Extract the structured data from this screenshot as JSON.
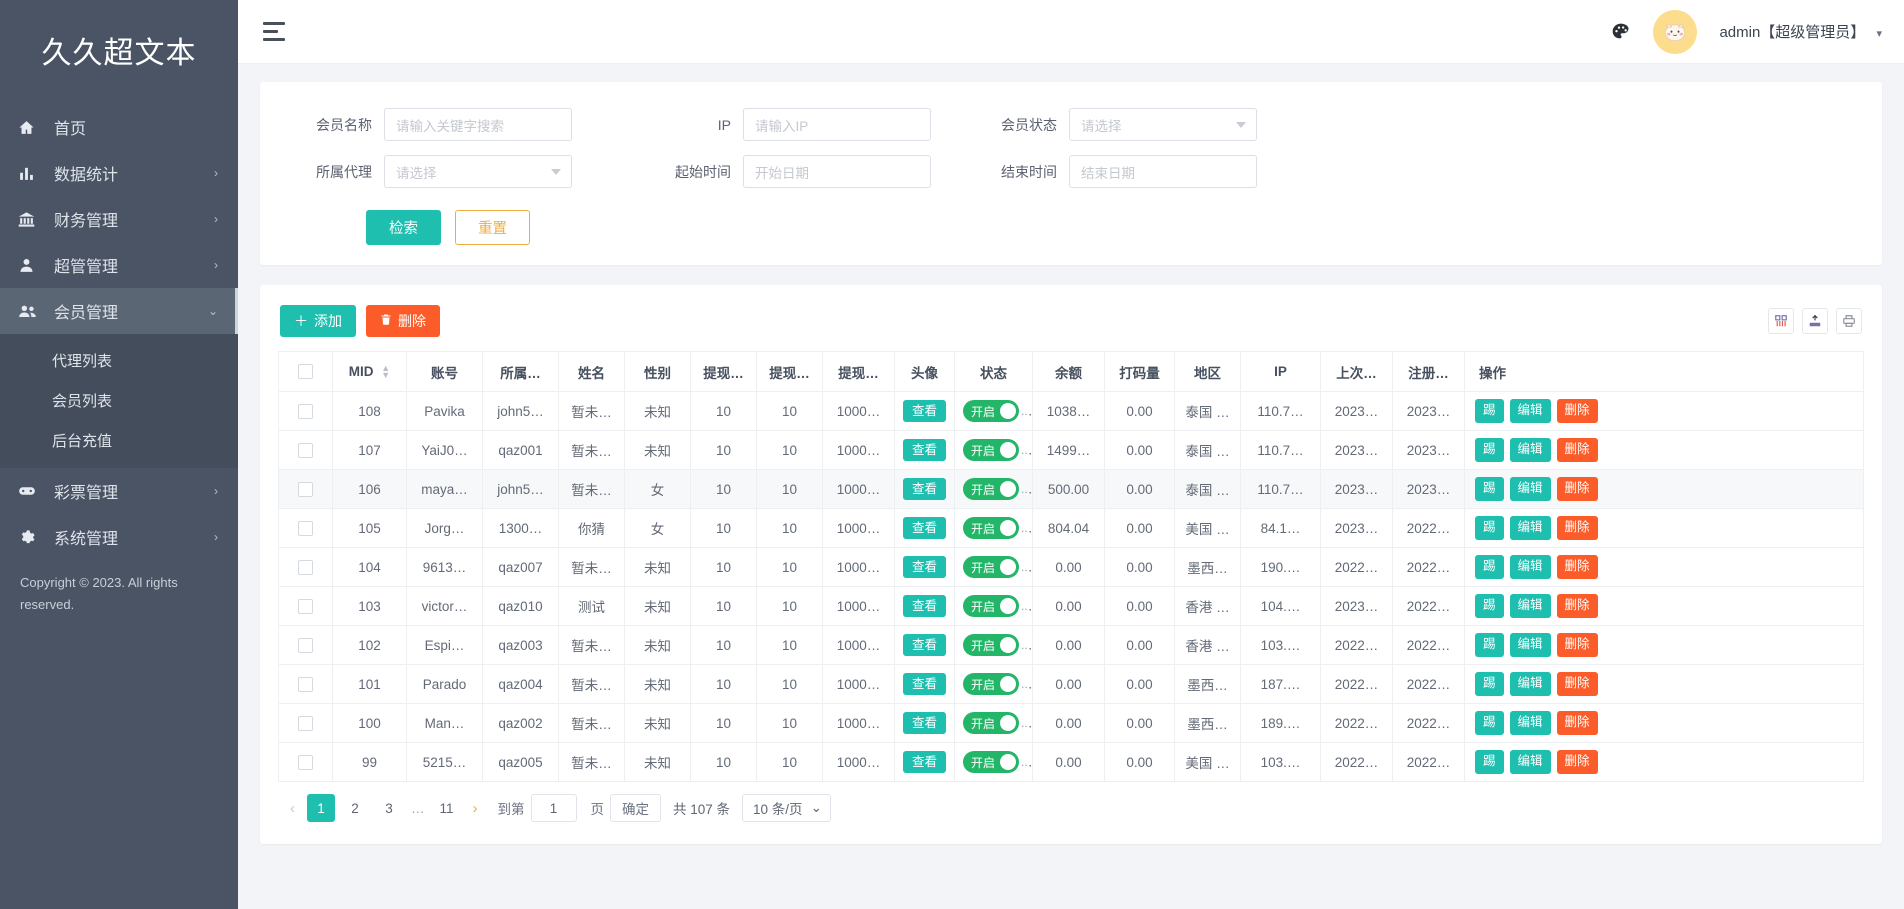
{
  "sidebar": {
    "brand": "久久超文本",
    "items": [
      {
        "label": "首页",
        "icon": "home-icon",
        "arrow": ""
      },
      {
        "label": "数据统计",
        "icon": "chart-bar-icon",
        "arrow": "›"
      },
      {
        "label": "财务管理",
        "icon": "bank-icon",
        "arrow": "›"
      },
      {
        "label": "超管管理",
        "icon": "user-icon",
        "arrow": "›"
      },
      {
        "label": "会员管理",
        "icon": "users-icon",
        "arrow": "⌄"
      },
      {
        "label": "彩票管理",
        "icon": "gamepad-icon",
        "arrow": "›"
      },
      {
        "label": "系统管理",
        "icon": "gear-icon",
        "arrow": "›"
      }
    ],
    "submenu": [
      "代理列表",
      "会员列表",
      "后台充值"
    ],
    "copyright": "Copyright © 2023. All rights reserved."
  },
  "topbar": {
    "menu_icon": "hamburger-icon",
    "palette_icon": "palette-icon",
    "avatar_icon": "avatar-cat-icon",
    "user": "admin【超级管理员】",
    "caret": "▾"
  },
  "search": {
    "fields": [
      {
        "label": "会员名称",
        "placeholder": "请输入关键字搜索",
        "type": "text"
      },
      {
        "label": "IP",
        "placeholder": "请输入IP",
        "type": "text"
      },
      {
        "label": "会员状态",
        "placeholder": "请选择",
        "type": "select"
      },
      {
        "label": "所属代理",
        "placeholder": "请选择",
        "type": "select"
      },
      {
        "label": "起始时间",
        "placeholder": "开始日期",
        "type": "date"
      },
      {
        "label": "结束时间",
        "placeholder": "结束日期",
        "type": "date"
      }
    ],
    "submit_label": "检索",
    "reset_label": "重置"
  },
  "toolbar": {
    "add_label": "添加",
    "add_icon": "plus-icon",
    "delete_label": "删除",
    "delete_icon": "trash-icon",
    "icons": [
      "columns-icon",
      "export-icon",
      "print-icon"
    ]
  },
  "table": {
    "columns": [
      "",
      "MID",
      "账号",
      "所属…",
      "姓名",
      "性别",
      "提现…",
      "提现…",
      "提现…",
      "头像",
      "状态",
      "余额",
      "打码量",
      "地区",
      "IP",
      "上次…",
      "注册…",
      "操作"
    ],
    "sort_column": "MID",
    "view_label": "查看",
    "status_on_label": "开启",
    "actions": [
      "踢",
      "编辑",
      "删除"
    ],
    "rows": [
      {
        "mid": "108",
        "account": "Pavika",
        "agent": "john5…",
        "name": "暂未…",
        "gender": "未知",
        "w1": "10",
        "w2": "10",
        "w3": "1000…",
        "balance": "1038…",
        "bet": "0.00",
        "region": "泰国 …",
        "ip": "110.7…",
        "last": "2023…",
        "reg": "2023…",
        "hover": false
      },
      {
        "mid": "107",
        "account": "YaiJ0…",
        "agent": "qaz001",
        "name": "暂未…",
        "gender": "未知",
        "w1": "10",
        "w2": "10",
        "w3": "1000…",
        "balance": "1499…",
        "bet": "0.00",
        "region": "泰国 …",
        "ip": "110.7…",
        "last": "2023…",
        "reg": "2023…",
        "hover": false
      },
      {
        "mid": "106",
        "account": "maya…",
        "agent": "john5…",
        "name": "暂未…",
        "gender": "女",
        "w1": "10",
        "w2": "10",
        "w3": "1000…",
        "balance": "500.00",
        "bet": "0.00",
        "region": "泰国 …",
        "ip": "110.7…",
        "last": "2023…",
        "reg": "2023…",
        "hover": true
      },
      {
        "mid": "105",
        "account": "Jorg…",
        "agent": "1300…",
        "name": "你猜",
        "gender": "女",
        "w1": "10",
        "w2": "10",
        "w3": "1000…",
        "balance": "804.04",
        "bet": "0.00",
        "region": "美国 …",
        "ip": "84.1…",
        "last": "2023…",
        "reg": "2022…",
        "hover": false
      },
      {
        "mid": "104",
        "account": "9613…",
        "agent": "qaz007",
        "name": "暂未…",
        "gender": "未知",
        "w1": "10",
        "w2": "10",
        "w3": "1000…",
        "balance": "0.00",
        "bet": "0.00",
        "region": "墨西…",
        "ip": "190.…",
        "last": "2022…",
        "reg": "2022…",
        "hover": false
      },
      {
        "mid": "103",
        "account": "victor…",
        "agent": "qaz010",
        "name": "测试",
        "gender": "未知",
        "w1": "10",
        "w2": "10",
        "w3": "1000…",
        "balance": "0.00",
        "bet": "0.00",
        "region": "香港 …",
        "ip": "104.…",
        "last": "2023…",
        "reg": "2022…",
        "hover": false
      },
      {
        "mid": "102",
        "account": "Espi…",
        "agent": "qaz003",
        "name": "暂未…",
        "gender": "未知",
        "w1": "10",
        "w2": "10",
        "w3": "1000…",
        "balance": "0.00",
        "bet": "0.00",
        "region": "香港 …",
        "ip": "103.…",
        "last": "2022…",
        "reg": "2022…",
        "hover": false
      },
      {
        "mid": "101",
        "account": "Parado",
        "agent": "qaz004",
        "name": "暂未…",
        "gender": "未知",
        "w1": "10",
        "w2": "10",
        "w3": "1000…",
        "balance": "0.00",
        "bet": "0.00",
        "region": "墨西…",
        "ip": "187.…",
        "last": "2022…",
        "reg": "2022…",
        "hover": false
      },
      {
        "mid": "100",
        "account": "Man…",
        "agent": "qaz002",
        "name": "暂未…",
        "gender": "未知",
        "w1": "10",
        "w2": "10",
        "w3": "1000…",
        "balance": "0.00",
        "bet": "0.00",
        "region": "墨西…",
        "ip": "189.…",
        "last": "2022…",
        "reg": "2022…",
        "hover": false
      },
      {
        "mid": "99",
        "account": "5215…",
        "agent": "qaz005",
        "name": "暂未…",
        "gender": "未知",
        "w1": "10",
        "w2": "10",
        "w3": "1000…",
        "balance": "0.00",
        "bet": "0.00",
        "region": "美国 …",
        "ip": "103.…",
        "last": "2022…",
        "reg": "2022…",
        "hover": false
      }
    ]
  },
  "pagination": {
    "prev": "‹",
    "next": "›",
    "pages": [
      "1",
      "2",
      "3"
    ],
    "ellipsis": "…",
    "last_page": "11",
    "current": "1",
    "goto_label": "到第",
    "goto_value": "1",
    "page_unit": "页",
    "confirm_label": "确定",
    "total_label": "共 107 条",
    "page_size": "10 条/页",
    "page_size_caret": "⌄"
  },
  "colors": {
    "sidebar_bg": "#4a5464",
    "submenu_bg": "#434d5c",
    "accent_teal": "#1fbfb0",
    "accent_orange": "#fc5c29",
    "reset_orange": "#f0ad3e",
    "switch_green": "#24b668",
    "danger_red": "#f5222d",
    "avatar_bg": "#fcdd8d"
  }
}
